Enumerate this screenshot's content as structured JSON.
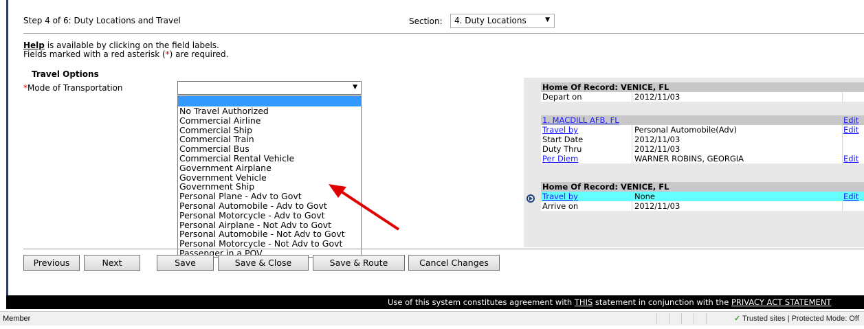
{
  "step": {
    "title": "Step 4 of 6: Duty Locations and Travel"
  },
  "section": {
    "label": "Section:",
    "selected": "4. Duty Locations"
  },
  "help": {
    "link": "Help",
    "text1": " is available by clicking on the field labels.",
    "text2a": "Fields marked with a red asterisk (",
    "star": "*",
    "text2b": ") are required."
  },
  "travel_options": {
    "heading": "Travel Options",
    "mot_label": "Mode of Transportation",
    "options": [
      "No Travel Authorized",
      "Commercial Airline",
      "Commercial Ship",
      "Commercial Train",
      "Commercial Bus",
      "Commercial Rental Vehicle",
      "Government Airplane",
      "Government Vehicle",
      "Government Ship",
      "Personal Plane - Adv to Govt",
      "Personal Automobile - Adv to Govt",
      "Personal Motorcycle - Adv to Govt",
      "Personal Airplane - Not Adv to Govt",
      "Personal Automobile - Not Adv to Govt",
      "Personal Motorcycle - Not Adv to Govt",
      "Passenger in a POV"
    ]
  },
  "buttons": {
    "previous": "Previous",
    "next": "Next",
    "save": "Save",
    "save_close": "Save & Close",
    "save_route": "Save & Route",
    "cancel": "Cancel Changes"
  },
  "itinerary": {
    "hor1": {
      "title": "Home Of Record: VENICE, FL",
      "depart_label": "Depart on",
      "depart_value": "2012/11/03"
    },
    "stop1": {
      "title": "1. MACDILL AFB, FL",
      "edit": "Edit",
      "travel_by_label": "Travel by",
      "travel_by_value": "Personal Automobile(Adv)",
      "start_label": "Start Date",
      "start_value": "2012/11/03",
      "duty_label": "Duty Thru",
      "duty_value": "2012/11/03",
      "per_diem_label": "Per Diem",
      "per_diem_value": "WARNER ROBINS, GEORGIA"
    },
    "hor2": {
      "title": "Home Of Record: VENICE, FL",
      "travel_by_label": "Travel by",
      "travel_by_value": "None",
      "arrive_label": "Arrive on",
      "arrive_value": "2012/11/03"
    }
  },
  "footer": {
    "pre": "Use of this system constitutes agreement with ",
    "this_link": "THIS",
    "mid": " statement in conjunction with the ",
    "privacy_link": "PRIVACY ACT STATEMENT"
  },
  "status_bar": {
    "left": "Member",
    "zone": "Trusted sites | Protected Mode: Off"
  },
  "colors": {
    "highlight_row": "#66ffff",
    "selection": "#3399ff",
    "footer_bg": "#000000",
    "arrow": "#e00000"
  }
}
